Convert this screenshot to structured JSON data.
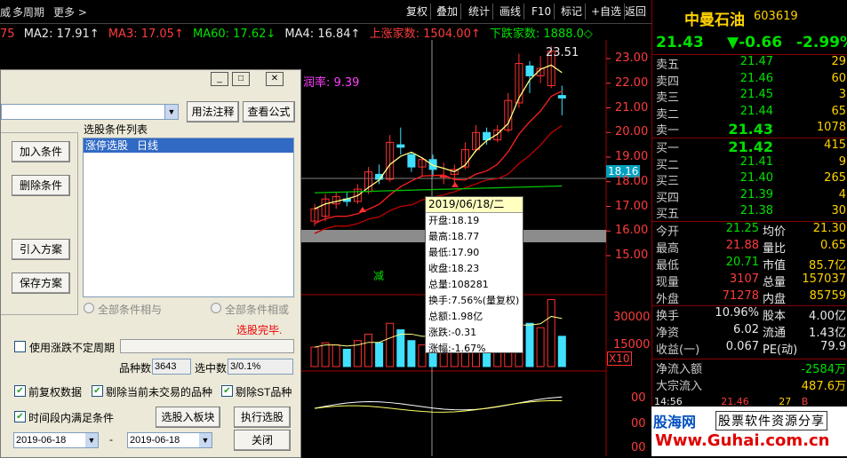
{
  "topbar": {
    "left_items": [
      "威",
      "多周期",
      "更多 >"
    ],
    "buttons": [
      "复权",
      "叠加",
      "统计",
      "画线",
      "F10",
      "标记",
      "+自选",
      "返回"
    ]
  },
  "ma_line": {
    "ma1": "75",
    "ma2": "MA2: 17.91↑",
    "ma3": "MA3: 17.05↑",
    "ma60": "MA60: 17.62↓",
    "ma4": "MA4: 16.84↑",
    "up_count": "上涨家数: 1504.00↑",
    "down_count": "下跌家数: 1888.0◇"
  },
  "chart_text": {
    "high_label": "23.51",
    "reduce_label": "减",
    "profit_label": "润率: 9.39",
    "x10": "X10",
    "crosshair_price": "18.16"
  },
  "chart_data": {
    "type": "candlestick",
    "price_axis": [
      "23.00",
      "22.00",
      "21.00",
      "20.00",
      "19.00",
      "18.00",
      "17.00",
      "16.00",
      "15.00"
    ],
    "volume_axis": [
      "30000",
      "15000"
    ],
    "ind_axis": [
      "00",
      "00",
      "00"
    ],
    "candles": [
      {
        "o": 16.4,
        "c": 16.9,
        "h": 17.1,
        "l": 16.2
      },
      {
        "o": 16.6,
        "c": 17.3,
        "h": 17.5,
        "l": 16.4
      },
      {
        "o": 17.1,
        "c": 17.4,
        "h": 17.6,
        "l": 16.9
      },
      {
        "o": 17.3,
        "c": 17.2,
        "h": 17.6,
        "l": 17.0
      },
      {
        "o": 17.2,
        "c": 17.7,
        "h": 17.9,
        "l": 17.1
      },
      {
        "o": 17.6,
        "c": 18.4,
        "h": 18.6,
        "l": 17.5
      },
      {
        "o": 18.3,
        "c": 18.1,
        "h": 18.7,
        "l": 17.9
      },
      {
        "o": 18.1,
        "c": 19.6,
        "h": 19.9,
        "l": 18.0
      },
      {
        "o": 19.5,
        "c": 19.4,
        "h": 20.2,
        "l": 19.1
      },
      {
        "o": 19.1,
        "c": 18.6,
        "h": 19.2,
        "l": 18.4
      },
      {
        "o": 18.6,
        "c": 18.9,
        "h": 19.0,
        "l": 18.2
      },
      {
        "o": 18.9,
        "c": 18.5,
        "h": 19.1,
        "l": 18.2
      },
      {
        "o": 18.19,
        "c": 18.23,
        "h": 18.77,
        "l": 17.9
      },
      {
        "o": 18.3,
        "c": 18.5,
        "h": 18.7,
        "l": 17.9
      },
      {
        "o": 18.6,
        "c": 19.3,
        "h": 19.6,
        "l": 18.5
      },
      {
        "o": 19.3,
        "c": 20.0,
        "h": 20.3,
        "l": 19.2
      },
      {
        "o": 20.0,
        "c": 19.7,
        "h": 20.2,
        "l": 19.5
      },
      {
        "o": 19.7,
        "c": 20.1,
        "h": 20.3,
        "l": 19.6
      },
      {
        "o": 20.1,
        "c": 21.3,
        "h": 21.6,
        "l": 20.0
      },
      {
        "o": 21.2,
        "c": 22.8,
        "h": 23.2,
        "l": 21.0
      },
      {
        "o": 22.7,
        "c": 22.3,
        "h": 22.9,
        "l": 21.6
      },
      {
        "o": 22.3,
        "c": 22.6,
        "h": 23.1,
        "l": 22.0
      },
      {
        "o": 21.9,
        "c": 23.3,
        "h": 23.51,
        "l": 21.8
      },
      {
        "o": 21.5,
        "c": 21.4,
        "h": 21.9,
        "l": 20.7
      }
    ],
    "volumes": [
      9000,
      11000,
      10000,
      8000,
      12000,
      15000,
      11000,
      20000,
      17000,
      12000,
      10000,
      11000,
      10800,
      14000,
      18000,
      20000,
      15000,
      14000,
      19000,
      28000,
      20000,
      18000,
      31000,
      14000
    ]
  },
  "quote": {
    "stock_name": "中曼石油",
    "stock_code": "603619",
    "price": "21.43",
    "change": "▼-0.66",
    "change_pct": "-2.99%",
    "asks": [
      {
        "label": "卖五",
        "price": "21.47",
        "vol": "29"
      },
      {
        "label": "卖四",
        "price": "21.46",
        "vol": "60"
      },
      {
        "label": "卖三",
        "price": "21.45",
        "vol": "3"
      },
      {
        "label": "卖二",
        "price": "21.44",
        "vol": "65"
      },
      {
        "label": "卖一",
        "price": "21.43",
        "vol": "1078"
      }
    ],
    "bids": [
      {
        "label": "买一",
        "price": "21.42",
        "vol": "415"
      },
      {
        "label": "买二",
        "price": "21.41",
        "vol": "9"
      },
      {
        "label": "买三",
        "price": "21.40",
        "vol": "265"
      },
      {
        "label": "买四",
        "price": "21.39",
        "vol": "4"
      },
      {
        "label": "买五",
        "price": "21.38",
        "vol": "30"
      }
    ],
    "stats1": [
      {
        "l1": "今开",
        "v1": "21.25",
        "l2": "均价",
        "v2": "21.30"
      },
      {
        "l1": "最高",
        "v1": "21.88",
        "l2": "量比",
        "v2": "0.65"
      },
      {
        "l1": "最低",
        "v1": "20.71",
        "l2": "市值",
        "v2": "85.7亿"
      },
      {
        "l1": "现量",
        "v1": "3107",
        "l2": "总量",
        "v2": "157037"
      },
      {
        "l1": "外盘",
        "v1": "71278",
        "l2": "内盘",
        "v2": "85759"
      }
    ],
    "stats2": [
      {
        "l1": "换手",
        "v1": "10.96%",
        "l2": "股本",
        "v2": "4.00亿"
      },
      {
        "l1": "净资",
        "v1": "6.02",
        "l2": "流通",
        "v2": "1.43亿"
      },
      {
        "l1": "收益(一)",
        "v1": "0.067",
        "l2": "PE(动)",
        "v2": "79.9"
      }
    ],
    "flow": [
      {
        "l": "净流入额",
        "v": "-2584万"
      },
      {
        "l": "大宗流入",
        "v": "487.6万"
      }
    ],
    "tick": {
      "time": "14:56",
      "price": "21.46",
      "vol": "27",
      "dir": "B"
    }
  },
  "watermark": {
    "brand": "股海网",
    "slogan": "股票软件资源分享",
    "url": "Www.Guhai.com.cn"
  },
  "dialog": {
    "select_label": "选股条件列表",
    "help_button": "用法注释",
    "formula_button": "查看公式",
    "list_items": [
      "涨停选股   日线"
    ],
    "add_condition": "加入条件",
    "delete_condition": "删除条件",
    "import_plan": "引入方案",
    "save_plan": "保存方案",
    "radio_and": "全部条件相与",
    "radio_or": "全部条件相或",
    "status": "选股完毕.",
    "variable_period": "使用涨跌不定周期",
    "stock_count_label": "品种数",
    "stock_count": "3643",
    "selected_label": "选中数",
    "selected": "3/0.1%",
    "opt_prev_adjust": "前复权数据",
    "opt_exclude_untraded": "剔除当前未交易的品种",
    "opt_exclude_st": "剔除ST品种",
    "opt_time_range": "时间段内满足条件",
    "to_block": "选股入板块",
    "run_select": "执行选股",
    "date_from": "2019-06-18",
    "date_sep": "-",
    "date_to": "2019-06-18",
    "close": "关闭"
  },
  "tooltip": {
    "date": "2019/06/18/二",
    "open": "开盘:18.19",
    "high": "最高:18.77",
    "low": "最低:17.90",
    "close": "收盘:18.23",
    "volume": "总量:108281",
    "turnover": "换手:7.56%(量复权)",
    "amount": "总额:1.98亿",
    "change": "涨跌:-0.31",
    "change_pct": "涨幅:-1.67%"
  }
}
